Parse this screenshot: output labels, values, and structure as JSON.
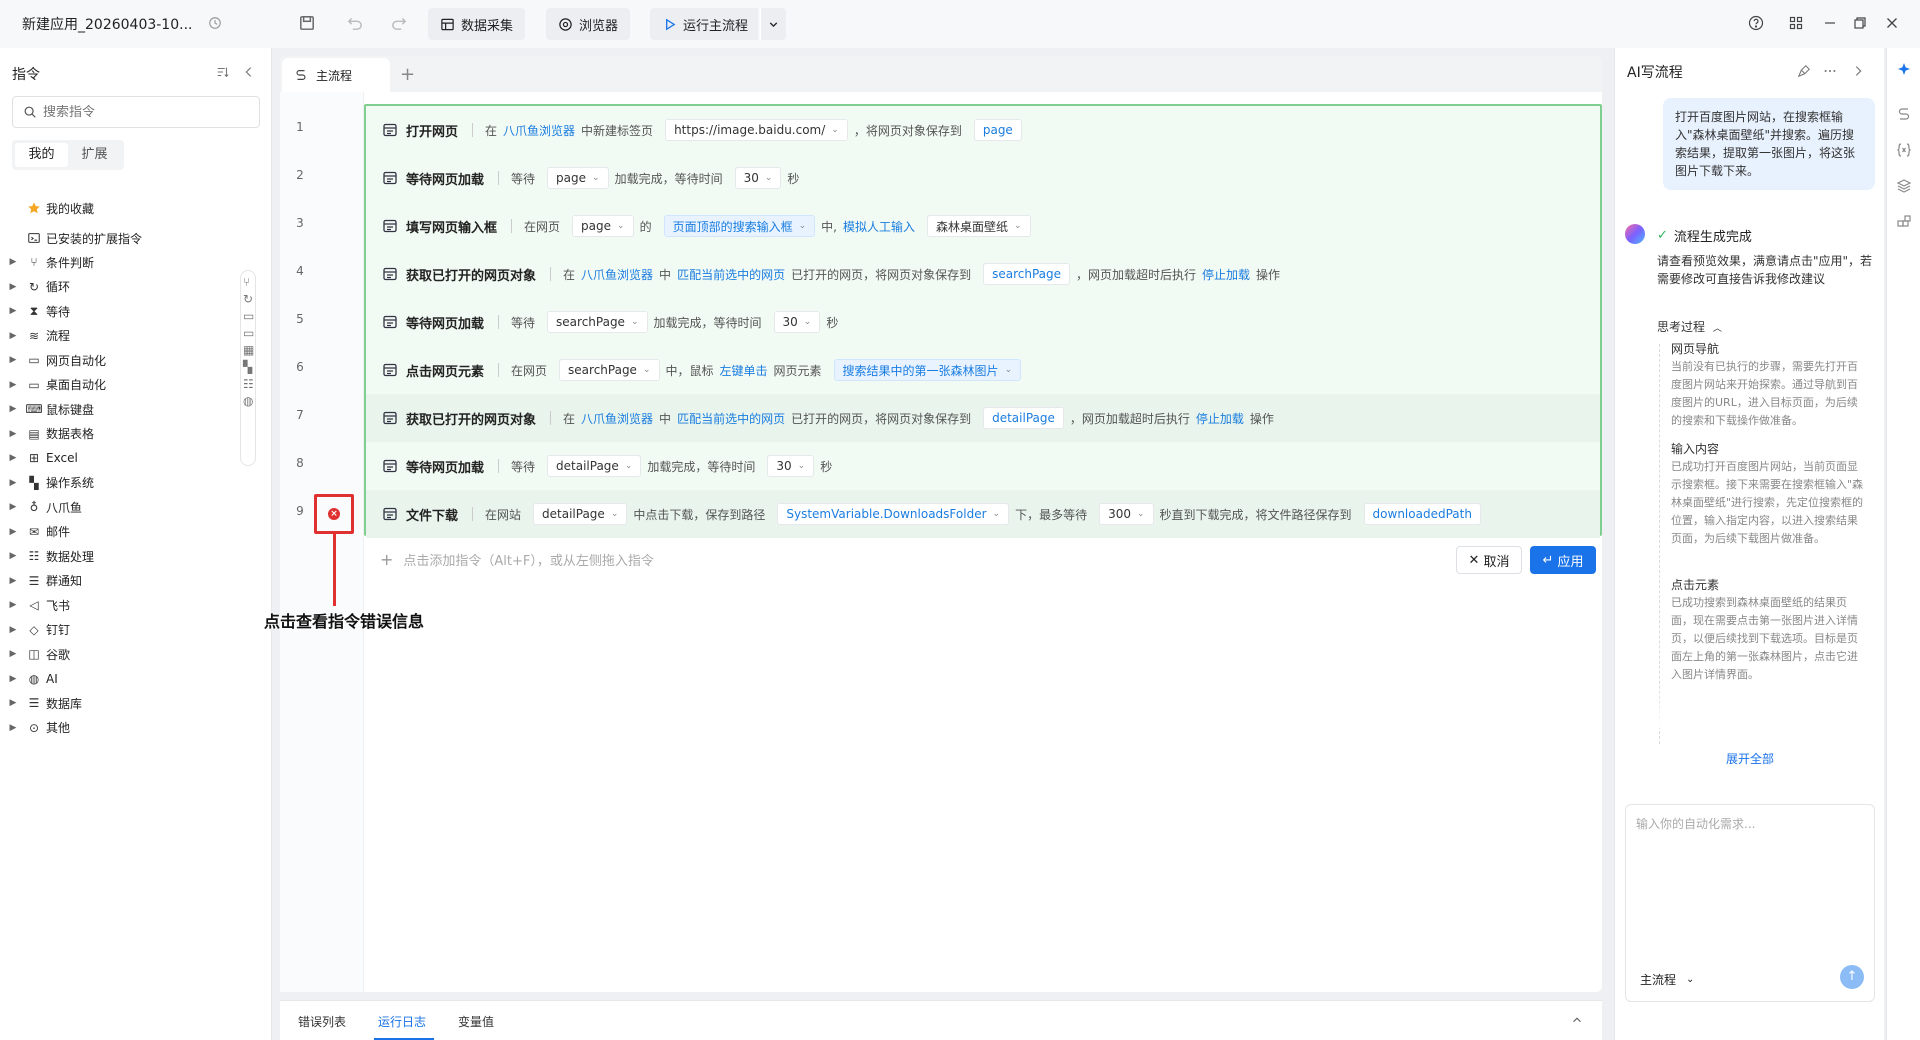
{
  "app": {
    "title": "新建应用_20260403-10...",
    "toolbar": {
      "data_collect": "数据采集",
      "browser": "浏览器",
      "run_main": "运行主流程"
    }
  },
  "left": {
    "title": "指令",
    "search_placeholder": "搜索指令",
    "tabs": [
      "我的",
      "扩展"
    ],
    "favorites": "我的收藏",
    "installed": "已安装的扩展指令",
    "categories": [
      "条件判断",
      "循环",
      "等待",
      "流程",
      "网页自动化",
      "桌面自动化",
      "鼠标键盘",
      "数据表格",
      "Excel",
      "操作系统",
      "八爪鱼",
      "邮件",
      "数据处理",
      "群通知",
      "飞书",
      "钉钉",
      "谷歌",
      "AI",
      "数据库",
      "其他"
    ]
  },
  "center": {
    "tab": "主流程",
    "lines": [
      "1",
      "2",
      "3",
      "4",
      "5",
      "6",
      "7",
      "8",
      "9"
    ],
    "rows": [
      {
        "name": "打开网页",
        "parts": [
          "在",
          "八爪鱼浏览器",
          "中新建标签页",
          "https://image.baidu.com/",
          "，将网页对象保存到",
          "page"
        ]
      },
      {
        "name": "等待网页加载",
        "parts": [
          "等待",
          "page",
          "加载完成，等待时间",
          "30",
          "秒"
        ]
      },
      {
        "name": "填写网页输入框",
        "parts": [
          "在网页",
          "page",
          "的",
          "页面顶部的搜索输入框",
          "中,",
          "模拟人工输入",
          "森林桌面壁纸"
        ]
      },
      {
        "name": "获取已打开的网页对象",
        "parts": [
          "在",
          "八爪鱼浏览器",
          "中",
          "匹配当前选中的网页",
          "已打开的网页，将网页对象保存到",
          "searchPage",
          "，网页加载超时后执行",
          "停止加载",
          "操作"
        ]
      },
      {
        "name": "等待网页加载",
        "parts": [
          "等待",
          "searchPage",
          "加载完成，等待时间",
          "30",
          "秒"
        ]
      },
      {
        "name": "点击网页元素",
        "parts": [
          "在网页",
          "searchPage",
          "中，鼠标",
          "左键单击",
          "网页元素",
          "搜索结果中的第一张森林图片"
        ]
      },
      {
        "name": "获取已打开的网页对象",
        "parts": [
          "在",
          "八爪鱼浏览器",
          "中",
          "匹配当前选中的网页",
          "已打开的网页，将网页对象保存到",
          "detailPage",
          "，网页加载超时后执行",
          "停止加载",
          "操作"
        ]
      },
      {
        "name": "等待网页加载",
        "parts": [
          "等待",
          "detailPage",
          "加载完成，等待时间",
          "30",
          "秒"
        ]
      },
      {
        "name": "文件下载",
        "parts": [
          "在网站",
          "detailPage",
          "中点击下载，保存到路径",
          "SystemVariable.DownloadsFolder",
          "下，最多等待",
          "300",
          "秒直到下载完成，将文件路径保存到",
          "downloadedPath"
        ]
      }
    ],
    "add_hint": "点击添加指令（Alt+F），或从左侧拖入指令",
    "cancel": "取消",
    "apply": "应用",
    "error_annotation": "点击查看指令错误信息"
  },
  "bottom": {
    "tabs": [
      "错误列表",
      "运行日志",
      "变量值"
    ]
  },
  "right": {
    "title": "AI写流程",
    "user_message": "打开百度图片网站，在搜索框输入\"森林桌面壁纸\"并搜索。遍历搜索结果，提取第一张图片，将这张图片下载下来。",
    "status": "流程生成完成",
    "status_desc": "请查看预览效果，满意请点击\"应用\"，若需要修改可直接告诉我修改建议",
    "thinking": "思考过程",
    "steps": [
      {
        "title": "网页导航",
        "text": "当前没有已执行的步骤，需要先打开百度图片网站来开始探索。通过导航到百度图片的URL，进入目标页面，为后续的搜索和下载操作做准备。"
      },
      {
        "title": "输入内容",
        "text": "已成功打开百度图片网站，当前页面显示搜索框。接下来需要在搜索框输入\"森林桌面壁纸\"进行搜索，先定位搜索框的位置，输入指定内容，以进入搜索结果页面，为后续下载图片做准备。"
      },
      {
        "title": "点击元素",
        "text": "已成功搜索到森林桌面壁纸的结果页面，现在需要点击第一张图片进入详情页，以便后续找到下载选项。目标是页面左上角的第一张森林图片，点击它进入图片详情界面。"
      }
    ],
    "expand_all": "展开全部",
    "input_placeholder": "输入你的自动化需求...",
    "flow_select": "主流程"
  }
}
